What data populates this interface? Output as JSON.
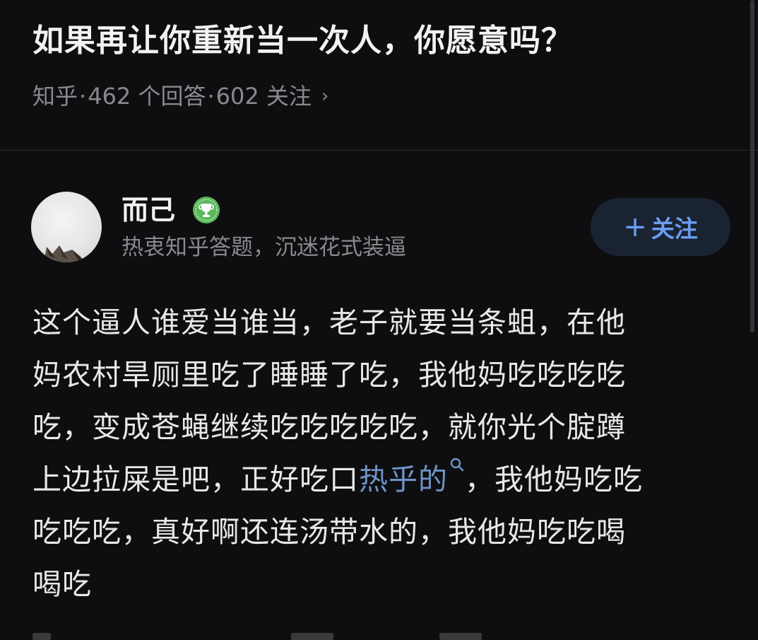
{
  "question": {
    "title": "如果再让你重新当一次人，你愿意吗？",
    "source": "知乎",
    "separator": "·",
    "answers_count": "462 个回答",
    "follows_count": "602 关注",
    "chevron_icon": "chevron-right-icon"
  },
  "author": {
    "name": "而己",
    "badge_icon": "trophy-badge-icon",
    "bio": "热衷知乎答题，沉迷花式装逼",
    "follow_label": "关注",
    "follow_icon": "plus-icon"
  },
  "answer": {
    "lines": [
      {
        "text": "这个逼人谁爱当谁当，老子就要当条蛆，在他"
      },
      {
        "text": "妈农村旱厕里吃了睡睡了吃，我他妈吃吃吃吃"
      },
      {
        "text": "吃，变成苍蝇继续吃吃吃吃吃，就你光个腚蹲"
      },
      {
        "before": "上边拉屎是吧，正好吃口",
        "link": "热乎的",
        "after": "，我他妈吃吃"
      },
      {
        "text": "吃吃吃，真好啊还连汤带水的，我他妈吃吃喝"
      },
      {
        "text": "喝吃"
      }
    ]
  },
  "colors": {
    "background": "#0e0e10",
    "link": "#6d94c8",
    "follow_button_text": "#6a9ef2",
    "badge_green": "#5cb85c"
  }
}
